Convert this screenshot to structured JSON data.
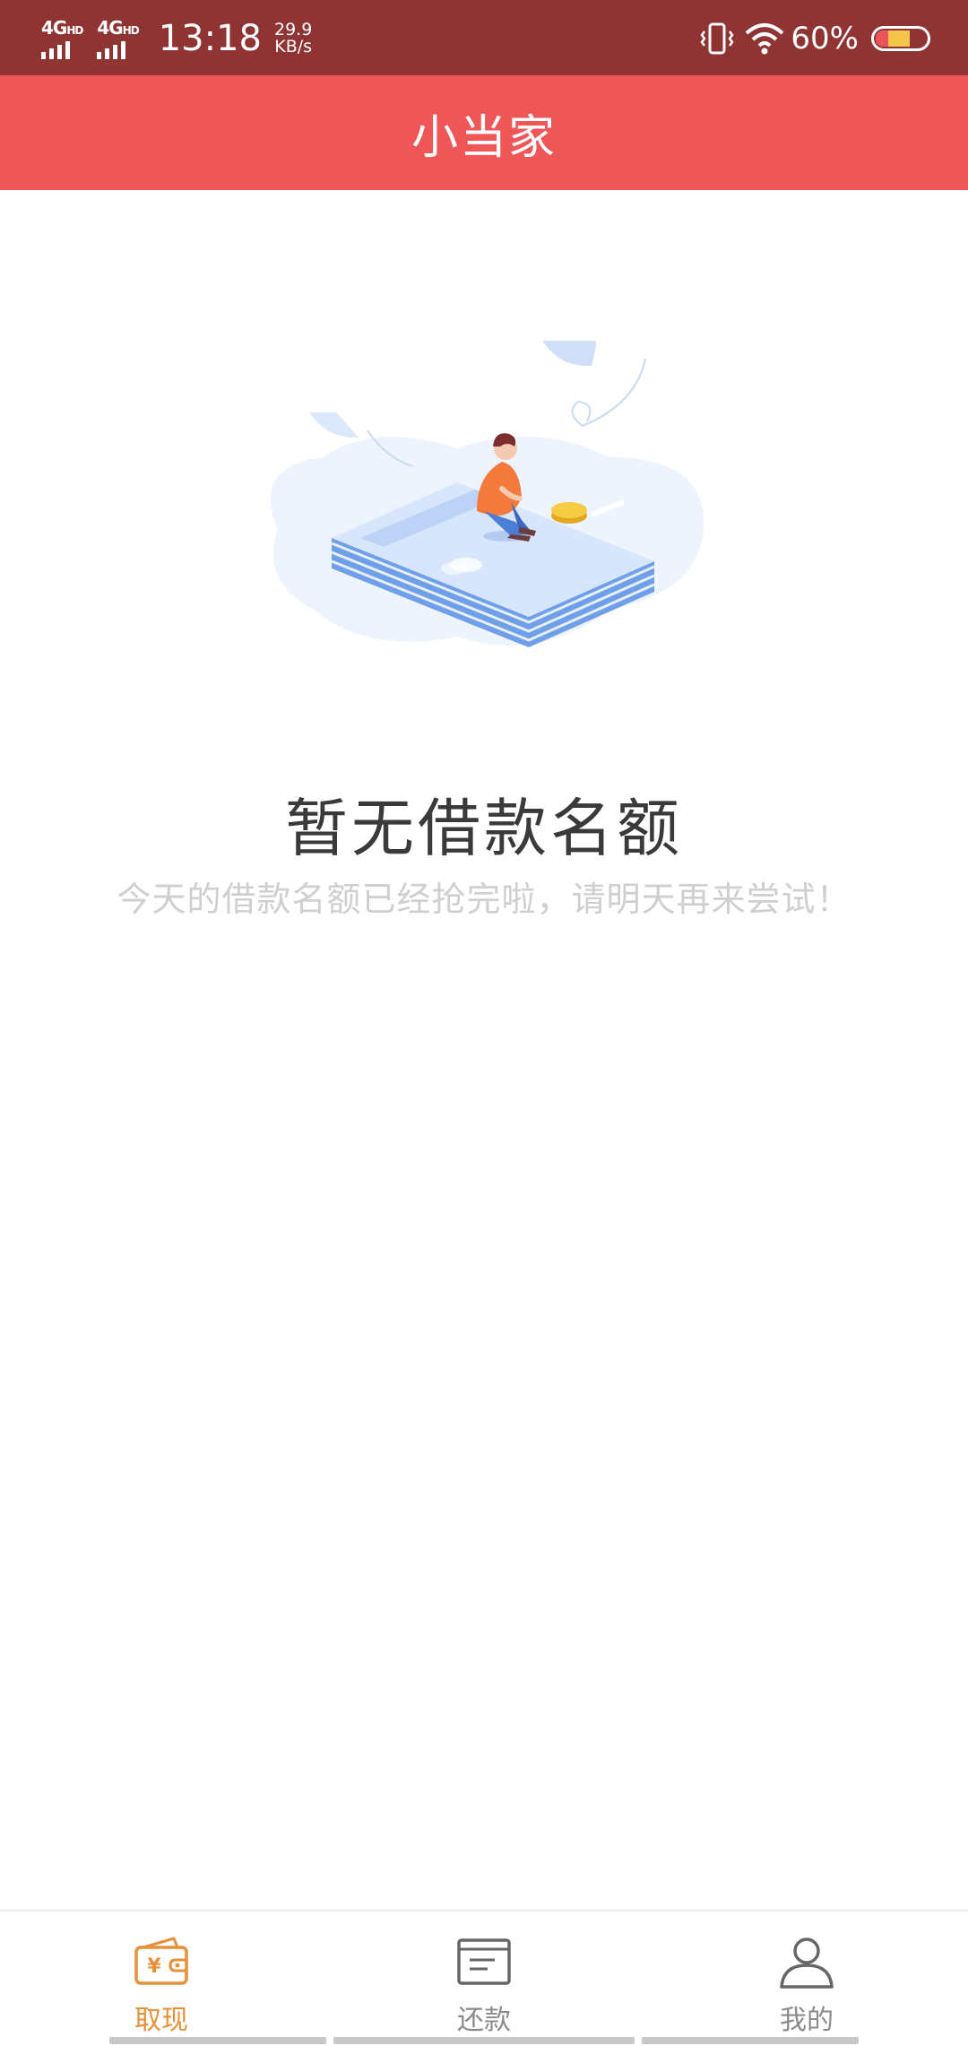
{
  "status_bar": {
    "network_1": "4G",
    "network_1_suffix": "HD",
    "network_2": "4G",
    "network_2_suffix": "HD",
    "time": "13:18",
    "speed_value": "29.9",
    "speed_unit": "KB/s",
    "battery_percent": "60%",
    "battery_level": 0.6,
    "icons": [
      "vibrate-icon",
      "wifi-icon",
      "battery-icon"
    ]
  },
  "header": {
    "title": "小当家"
  },
  "empty_state": {
    "title": "暂无借款名额",
    "subtitle": "今天的借款名额已经抢完啦，请明天再来尝试！"
  },
  "tabbar": {
    "tabs": [
      {
        "label": "取现",
        "icon": "wallet-yen-icon",
        "active": true
      },
      {
        "label": "还款",
        "icon": "bill-icon",
        "active": false
      },
      {
        "label": "我的",
        "icon": "person-icon",
        "active": false
      }
    ]
  },
  "colors": {
    "status_bar": "#8f3333",
    "header": "#ef5658",
    "active_tab": "#e7913a",
    "inactive_tab": "#8a8a8a"
  }
}
